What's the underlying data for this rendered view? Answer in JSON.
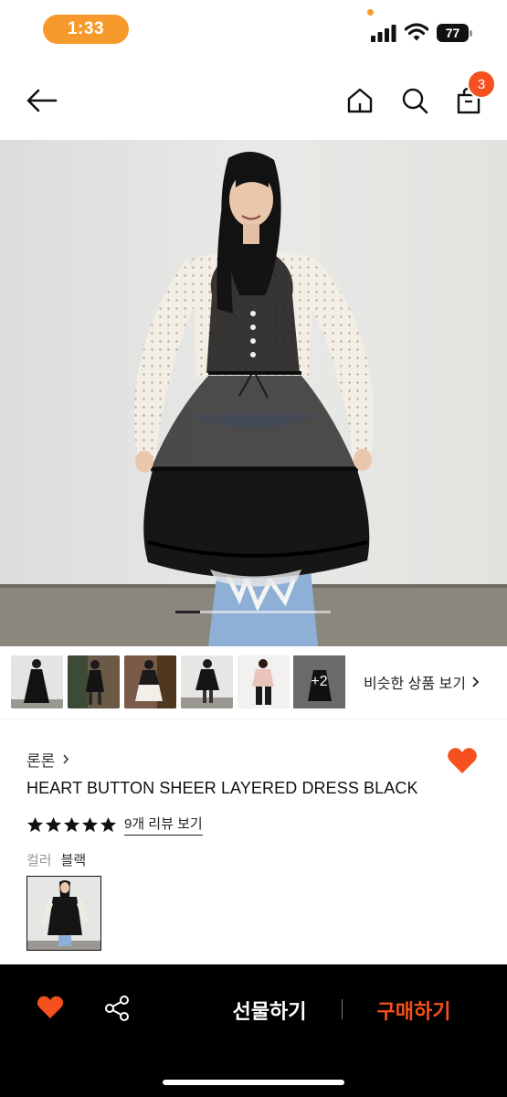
{
  "status_bar": {
    "time": "1:33",
    "battery": "77",
    "icons": [
      "signal-icon",
      "wifi-icon",
      "battery-icon"
    ],
    "accent": "#f79a2c"
  },
  "header": {
    "icons": [
      "back-arrow-icon",
      "home-icon",
      "search-icon",
      "shopping-bag-icon"
    ],
    "cart_count": "3",
    "badge_color": "#f4511e"
  },
  "gallery": {
    "active_slide_fraction": 0.16
  },
  "thumbnails": {
    "more_count": "+2",
    "similar_link": "비슷한 상품 보기"
  },
  "product": {
    "brand": "론론",
    "title": "HEART BUTTON SHEER LAYERED DRESS BLACK",
    "rating": 5,
    "review_link": "9개 리뷰 보기",
    "color_label": "컬러",
    "color_value": "블랙",
    "heart_color": "#f4511e"
  },
  "bottom_bar": {
    "gift_label": "선물하기",
    "buy_label": "구매하기",
    "buy_color": "#f4511e"
  }
}
